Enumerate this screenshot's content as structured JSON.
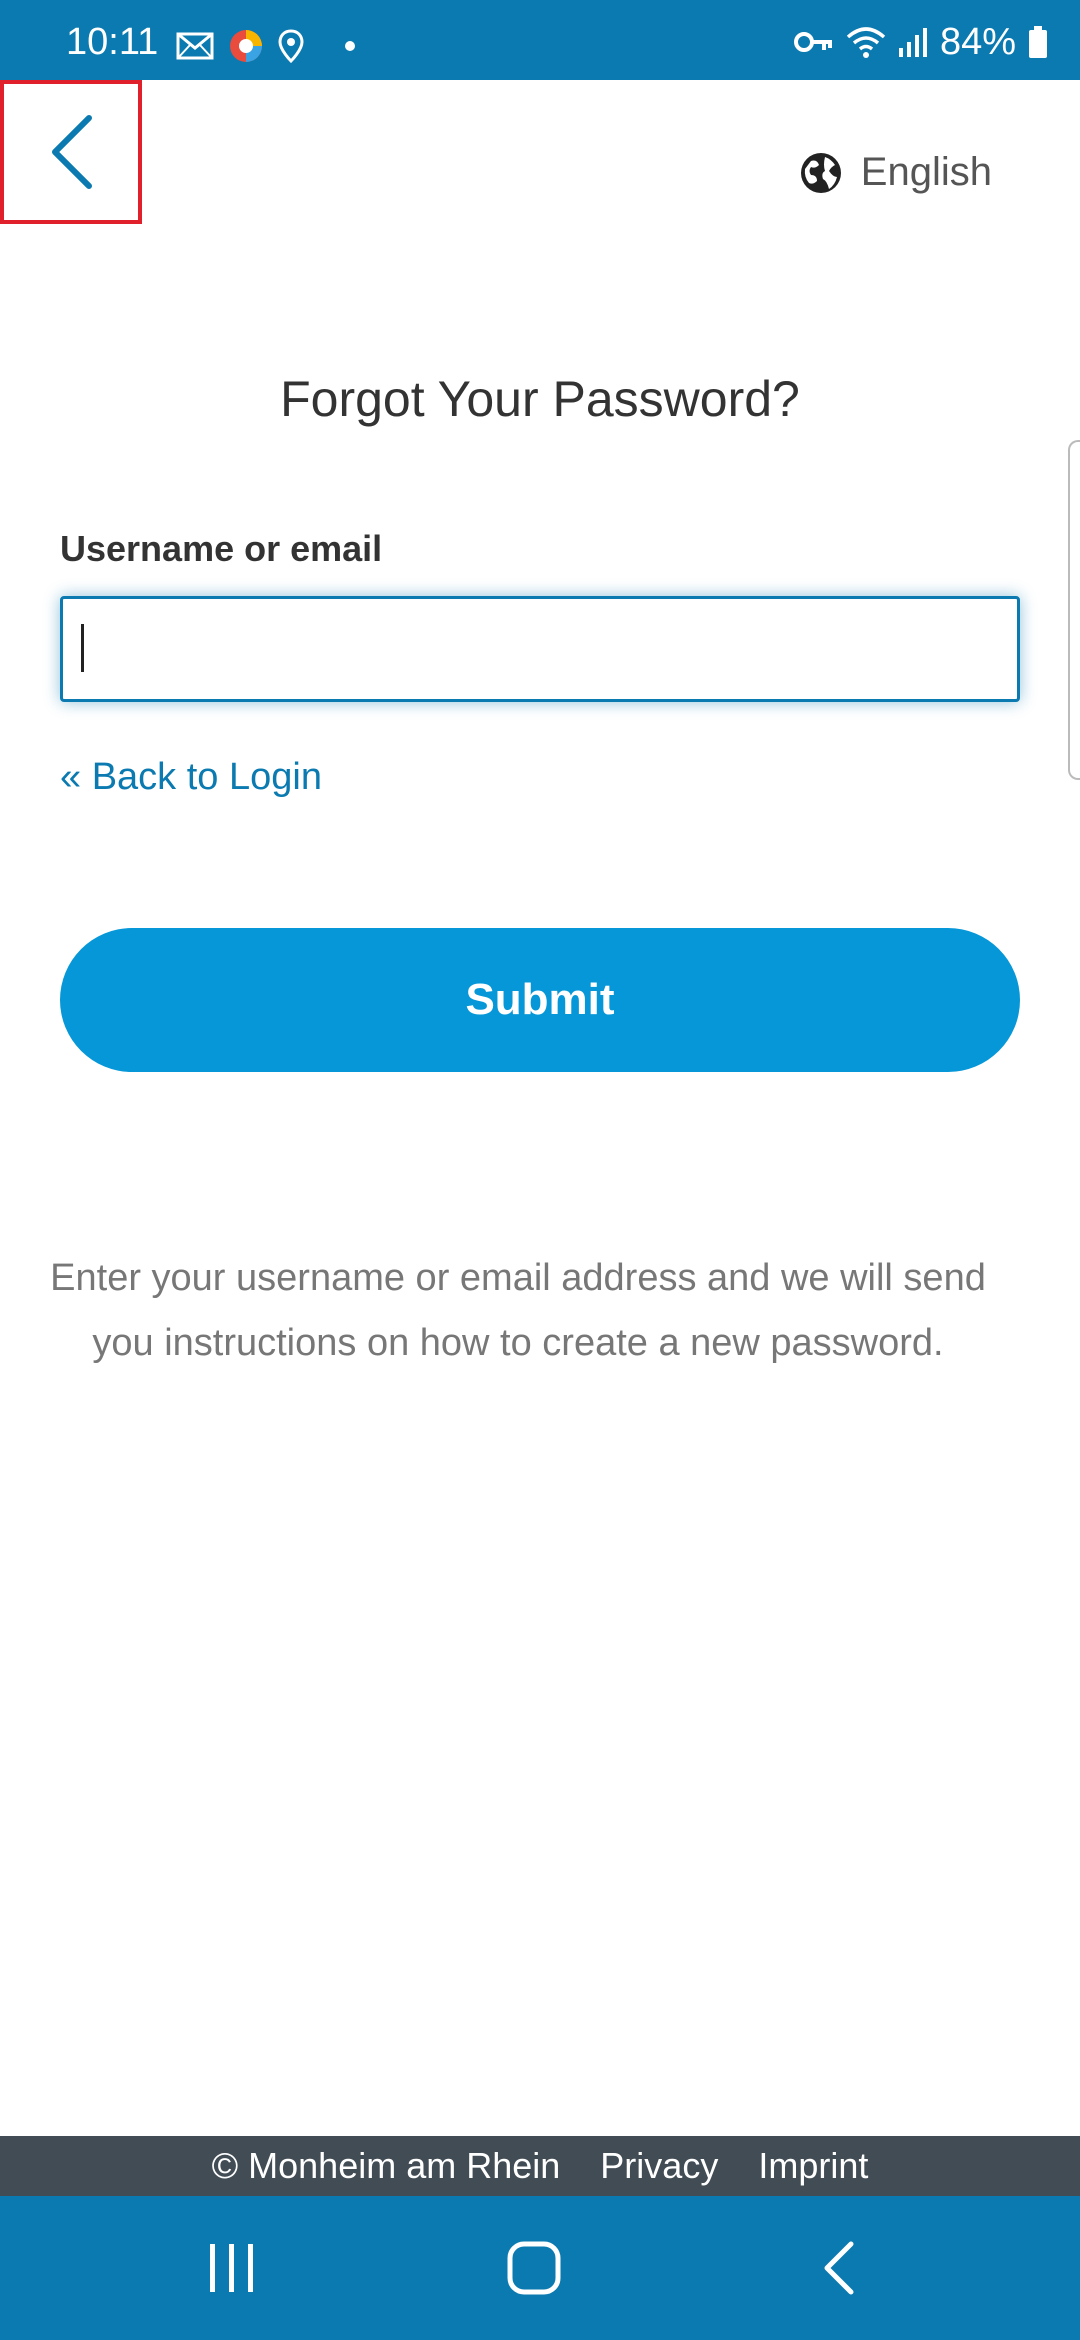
{
  "status_bar": {
    "time": "10:11",
    "battery": "84%",
    "icons": [
      "mail-icon",
      "browser-icon",
      "location-icon",
      "dot-icon",
      "key-icon",
      "wifi-icon",
      "signal-icon",
      "battery-icon"
    ]
  },
  "header": {
    "back_icon": "chevron-left-icon",
    "language_icon": "globe-icon",
    "language": "English"
  },
  "form": {
    "title": "Forgot Your Password?",
    "username_label": "Username or email",
    "username_value": "",
    "back_to_login": "« Back to Login",
    "submit_label": "Submit",
    "instructions": "Enter your username or email address and we will send you instructions on how to create a new password."
  },
  "footer": {
    "copyright": "© Monheim am Rhein",
    "privacy": "Privacy",
    "imprint": "Imprint"
  },
  "nav_bar": {
    "icons": [
      "recent-apps-icon",
      "home-icon",
      "back-icon"
    ]
  },
  "colors": {
    "primary": "#0a7ab0",
    "button": "#0597d8",
    "footer_bg": "#414c55",
    "highlight_box": "#e0202a"
  }
}
